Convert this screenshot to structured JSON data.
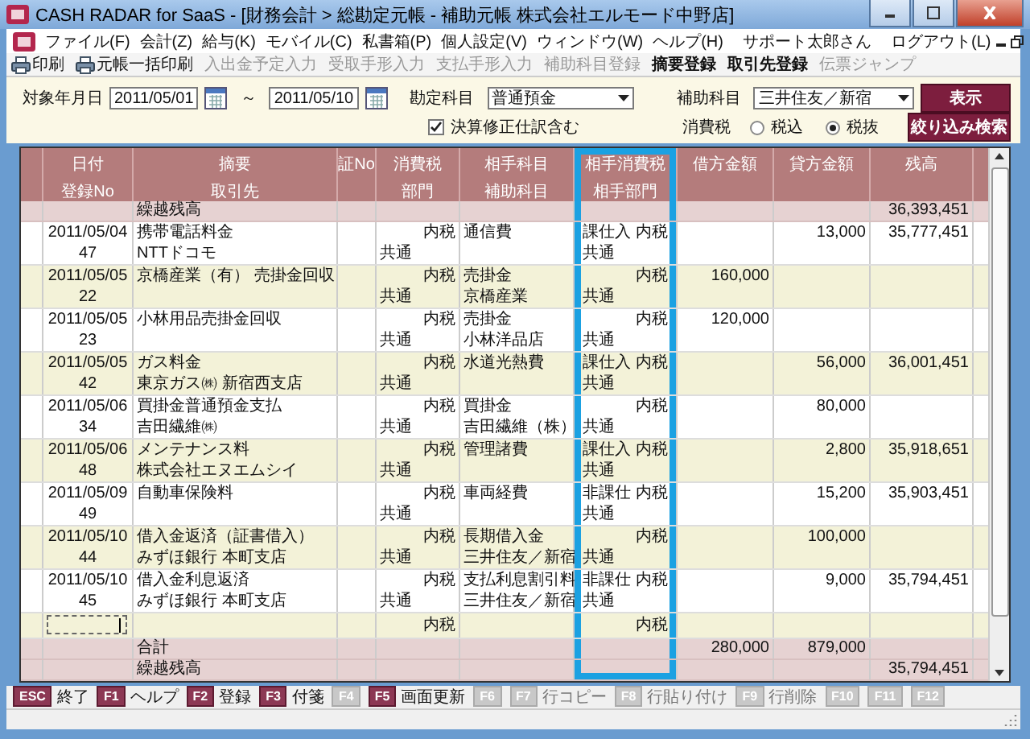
{
  "window": {
    "title": "CASH RADAR for SaaS - [財務会計 > 総勘定元帳 - 補助元帳 株式会社エルモード中野店]"
  },
  "menu": {
    "items": [
      "ファイル(F)",
      "会計(Z)",
      "給与(K)",
      "モバイル(C)",
      "私書箱(P)",
      "個人設定(V)",
      "ウィンドウ(W)",
      "ヘルプ(H)"
    ],
    "user": "サポート太郎さん",
    "logout": "ログアウト(L)"
  },
  "toolbar": [
    {
      "label": "印刷",
      "kind": "print",
      "disabled": false
    },
    {
      "label": "元帳一括印刷",
      "kind": "print",
      "disabled": false
    },
    {
      "label": "入出金予定入力",
      "kind": "text",
      "disabled": true
    },
    {
      "label": "受取手形入力",
      "kind": "text",
      "disabled": true
    },
    {
      "label": "支払手形入力",
      "kind": "text",
      "disabled": true
    },
    {
      "label": "補助科目登録",
      "kind": "text",
      "disabled": true
    },
    {
      "label": "摘要登録",
      "kind": "text",
      "disabled": false
    },
    {
      "label": "取引先登録",
      "kind": "text",
      "disabled": false
    },
    {
      "label": "伝票ジャンプ",
      "kind": "text",
      "disabled": true
    }
  ],
  "filter": {
    "date_label": "対象年月日",
    "date_from": "2011/05/01",
    "range_sep": "～",
    "date_to": "2011/05/10",
    "account_label": "勘定科目",
    "account": "普通預金",
    "sub_account_label": "補助科目",
    "sub_account": "三井住友／新宿",
    "show_button": "表示",
    "include_adjust": {
      "label": "決算修正仕訳含む",
      "checked": true
    },
    "tax_label": "消費税",
    "tax_options": [
      {
        "label": "税込",
        "selected": false
      },
      {
        "label": "税抜",
        "selected": true
      }
    ],
    "search_button": "絞り込み検索"
  },
  "table": {
    "columns": [
      {
        "top": "日付",
        "bottom": "登録No",
        "highlighted": false
      },
      {
        "top": "摘要",
        "bottom": "取引先",
        "highlighted": false
      },
      {
        "top": "証No",
        "highlighted": false
      },
      {
        "top": "消費税",
        "bottom": "部門",
        "highlighted": false
      },
      {
        "top": "相手科目",
        "bottom": "補助科目",
        "highlighted": false
      },
      {
        "top": "相手消費税",
        "bottom": "相手部門",
        "highlighted": true
      },
      {
        "top": "借方金額",
        "highlighted": false
      },
      {
        "top": "貸方金額",
        "highlighted": false
      },
      {
        "top": "残高",
        "highlighted": false
      }
    ],
    "carry_forward": {
      "label": "繰越残高",
      "balance": "36,393,451"
    },
    "rows": [
      {
        "date": "2011/05/04",
        "no": "47",
        "memo": "携帯電話料金",
        "partner": "NTTドコモ",
        "tax": "内税",
        "dept": "共通",
        "account": "通信費",
        "p_tax_class": "課仕入",
        "p_tax": "内税",
        "p_dept": "共通",
        "credit": "13,000",
        "balance": "35,777,451"
      },
      {
        "date": "2011/05/05",
        "no": "22",
        "memo": "京橋産業（有） 売掛金回収",
        "tax": "内税",
        "dept": "共通",
        "account": "売掛金",
        "sub_account": "京橋産業",
        "p_tax": "内税",
        "p_dept": "共通",
        "debit": "160,000"
      },
      {
        "date": "2011/05/05",
        "no": "23",
        "memo": "小林用品売掛金回収",
        "tax": "内税",
        "dept": "共通",
        "account": "売掛金",
        "sub_account": "小林洋品店",
        "p_tax": "内税",
        "p_dept": "共通",
        "debit": "120,000"
      },
      {
        "date": "2011/05/05",
        "no": "42",
        "memo": "ガス料金",
        "partner": "東京ガス㈱ 新宿西支店",
        "tax": "内税",
        "dept": "共通",
        "account": "水道光熱費",
        "p_tax_class": "課仕入",
        "p_tax": "内税",
        "p_dept": "共通",
        "credit": "56,000",
        "balance": "36,001,451"
      },
      {
        "date": "2011/05/06",
        "no": "34",
        "memo": "買掛金普通預金支払",
        "partner": "吉田繊維㈱",
        "tax": "内税",
        "dept": "共通",
        "account": "買掛金",
        "sub_account": "吉田繊維（株）",
        "p_tax": "内税",
        "p_dept": "共通",
        "credit": "80,000"
      },
      {
        "date": "2011/05/06",
        "no": "48",
        "memo": "メンテナンス料",
        "partner": "株式会社エヌエムシイ",
        "tax": "内税",
        "dept": "共通",
        "account": "管理諸費",
        "p_tax_class": "課仕入",
        "p_tax": "内税",
        "p_dept": "共通",
        "credit": "2,800",
        "balance": "35,918,651"
      },
      {
        "date": "2011/05/09",
        "no": "49",
        "memo": "自動車保険料",
        "tax": "内税",
        "dept": "共通",
        "account": "車両経費",
        "p_tax_class": "非課仕",
        "p_tax": "内税",
        "p_dept": "共通",
        "credit": "15,200",
        "balance": "35,903,451"
      },
      {
        "date": "2011/05/10",
        "no": "44",
        "memo": "借入金返済（証書借入）",
        "partner": "みずほ銀行 本町支店",
        "tax": "内税",
        "dept": "共通",
        "account": "長期借入金",
        "sub_account": "三井住友／新宿",
        "p_tax": "内税",
        "p_dept": "共通",
        "credit": "100,000"
      },
      {
        "date": "2011/05/10",
        "no": "45",
        "memo": "借入金利息返済",
        "partner": "みずほ銀行 本町支店",
        "tax": "内税",
        "dept": "共通",
        "account": "支払利息割引料",
        "sub_account": "三井住友／新宿",
        "p_tax_class": "非課仕",
        "p_tax": "内税",
        "p_dept": "共通",
        "credit": "9,000",
        "balance": "35,794,451"
      }
    ],
    "input_row": {
      "tax": "内税",
      "p_tax": "内税"
    },
    "total": {
      "label": "合計",
      "debit": "280,000",
      "credit": "879,000"
    },
    "closing": {
      "label": "繰越残高",
      "balance": "35,794,451"
    }
  },
  "function_keys": [
    {
      "key": "ESC",
      "label": "終了",
      "disabled": false
    },
    {
      "key": "F1",
      "label": "ヘルプ",
      "disabled": false
    },
    {
      "key": "F2",
      "label": "登録",
      "disabled": false
    },
    {
      "key": "F3",
      "label": "付箋",
      "disabled": false
    },
    {
      "key": "F4",
      "disabled": true
    },
    {
      "key": "F5",
      "label": "画面更新",
      "disabled": false
    },
    {
      "key": "F6",
      "disabled": true
    },
    {
      "key": "F7",
      "label": "行コピー",
      "disabled": true
    },
    {
      "key": "F8",
      "label": "行貼り付け",
      "disabled": true
    },
    {
      "key": "F9",
      "label": "行削除",
      "disabled": true
    },
    {
      "key": "F10",
      "disabled": true
    },
    {
      "key": "F11",
      "disabled": true
    },
    {
      "key": "F12",
      "disabled": true
    }
  ]
}
